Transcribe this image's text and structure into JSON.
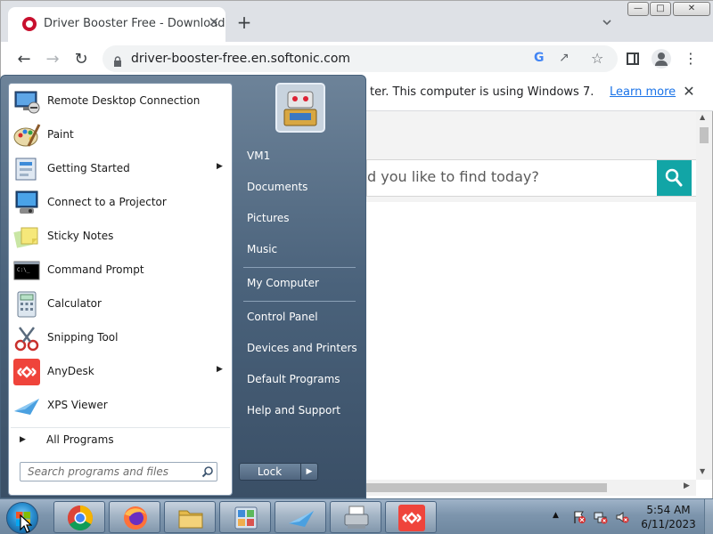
{
  "browser": {
    "tab_title": "Driver Booster Free - Download",
    "tab_close": "✕",
    "new_tab": "+",
    "url": "driver-booster-free.en.softonic.com",
    "infobar_text": "ter. This computer is using Windows 7.",
    "learn_more": "Learn more",
    "infobar_close": "✕",
    "page_search_placeholder": "d you like to find today?",
    "accent_color": "#12a5a6"
  },
  "start_menu": {
    "programs": [
      {
        "label": "Remote Desktop Connection",
        "icon": "remote-desktop-icon",
        "has_submenu": false
      },
      {
        "label": "Paint",
        "icon": "paint-icon",
        "has_submenu": false
      },
      {
        "label": "Getting Started",
        "icon": "getting-started-icon",
        "has_submenu": true
      },
      {
        "label": "Connect to a Projector",
        "icon": "projector-icon",
        "has_submenu": false
      },
      {
        "label": "Sticky Notes",
        "icon": "sticky-notes-icon",
        "has_submenu": false
      },
      {
        "label": "Command Prompt",
        "icon": "command-prompt-icon",
        "has_submenu": false
      },
      {
        "label": "Calculator",
        "icon": "calculator-icon",
        "has_submenu": false
      },
      {
        "label": "Snipping Tool",
        "icon": "snipping-tool-icon",
        "has_submenu": false
      },
      {
        "label": "AnyDesk",
        "icon": "anydesk-icon",
        "has_submenu": true
      },
      {
        "label": "XPS Viewer",
        "icon": "xps-viewer-icon",
        "has_submenu": false
      }
    ],
    "all_programs": "All Programs",
    "search_placeholder": "Search programs and files",
    "right_items": [
      "VM1",
      "Documents",
      "Pictures",
      "Music",
      "My Computer",
      "Control Panel",
      "Devices and Printers",
      "Default Programs",
      "Help and Support"
    ],
    "lock_label": "Lock"
  },
  "taskbar": {
    "pinned": [
      "chrome-icon",
      "firefox-icon",
      "file-explorer-icon",
      "control-panel-icon",
      "xps-viewer-icon",
      "fax-scan-icon",
      "anydesk-icon"
    ],
    "clock_time": "5:54 AM",
    "clock_date": "6/11/2023"
  }
}
